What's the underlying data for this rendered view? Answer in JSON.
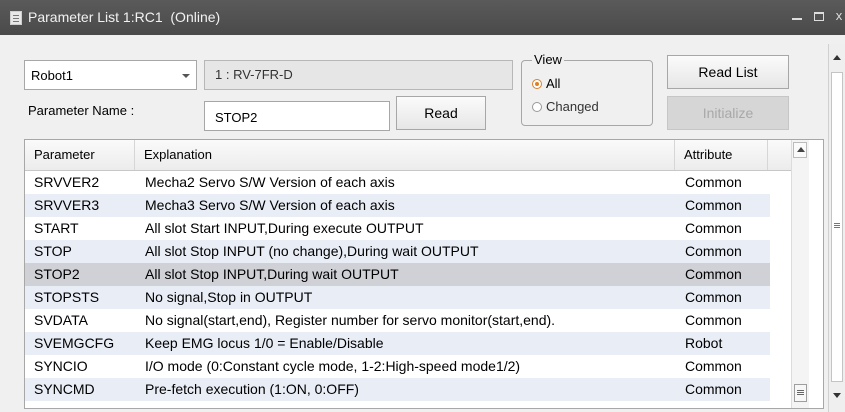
{
  "window": {
    "title": "Parameter List 1:RC1  (Online)",
    "minimize_glyph": "",
    "maximize_glyph": "",
    "close_glyph": "x"
  },
  "controls": {
    "robot_select": "Robot1",
    "robot_model": "1 : RV-7FR-D",
    "param_name_label": "Parameter Name :",
    "param_name_value": "STOP2",
    "read_button": "Read",
    "read_list_button": "Read List",
    "initialize_button": "Initialize",
    "view": {
      "legend": "View",
      "options": [
        {
          "label": "All",
          "selected": true
        },
        {
          "label": "Changed",
          "selected": false
        }
      ]
    }
  },
  "table": {
    "headers": [
      "Parameter",
      "Explanation",
      "Attribute"
    ],
    "rows": [
      {
        "parameter": "SRVVER2",
        "explanation": "Mecha2 Servo S/W Version of each axis",
        "attribute": "Common"
      },
      {
        "parameter": "SRVVER3",
        "explanation": "Mecha3 Servo S/W Version of each axis",
        "attribute": "Common"
      },
      {
        "parameter": "START",
        "explanation": "All slot Start INPUT,During execute OUTPUT",
        "attribute": "Common"
      },
      {
        "parameter": "STOP",
        "explanation": "All slot Stop INPUT (no change),During wait OUTPUT",
        "attribute": "Common"
      },
      {
        "parameter": "STOP2",
        "explanation": "All slot Stop INPUT,During wait OUTPUT",
        "attribute": "Common"
      },
      {
        "parameter": "STOPSTS",
        "explanation": "No signal,Stop in OUTPUT",
        "attribute": "Common"
      },
      {
        "parameter": "SVDATA",
        "explanation": "No signal(start,end), Register number for servo monitor(start,end).",
        "attribute": "Common"
      },
      {
        "parameter": "SVEMGCFG",
        "explanation": "Keep EMG locus 1/0 = Enable/Disable",
        "attribute": "Robot"
      },
      {
        "parameter": "SYNCIO",
        "explanation": "I/O mode (0:Constant cycle mode, 1-2:High-speed mode1/2)",
        "attribute": "Common"
      },
      {
        "parameter": "SYNCMD",
        "explanation": "Pre-fetch execution (1:ON, 0:OFF)",
        "attribute": "Common"
      }
    ],
    "selected_parameter": "STOP2"
  }
}
